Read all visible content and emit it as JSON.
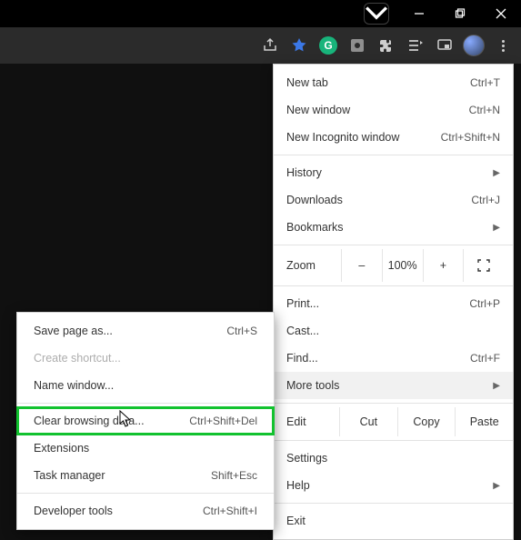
{
  "window_controls": {
    "minimize": "–",
    "maximize": "▢",
    "close": "✕"
  },
  "toolbar": {
    "icons": [
      "share-icon",
      "bookmark-star-icon",
      "grammarly-icon",
      "capture-icon",
      "extensions-puzzle-icon",
      "reading-list-icon",
      "cast-icon",
      "profile-avatar",
      "menu-kebab-icon"
    ]
  },
  "menu": {
    "new_tab": {
      "label": "New tab",
      "shortcut": "Ctrl+T"
    },
    "new_window": {
      "label": "New window",
      "shortcut": "Ctrl+N"
    },
    "new_incognito": {
      "label": "New Incognito window",
      "shortcut": "Ctrl+Shift+N"
    },
    "history": {
      "label": "History"
    },
    "downloads": {
      "label": "Downloads",
      "shortcut": "Ctrl+J"
    },
    "bookmarks": {
      "label": "Bookmarks"
    },
    "zoom": {
      "label": "Zoom",
      "minus": "–",
      "value": "100%",
      "plus": "+"
    },
    "print": {
      "label": "Print...",
      "shortcut": "Ctrl+P"
    },
    "cast": {
      "label": "Cast..."
    },
    "find": {
      "label": "Find...",
      "shortcut": "Ctrl+F"
    },
    "more_tools": {
      "label": "More tools"
    },
    "edit": {
      "label": "Edit",
      "cut": "Cut",
      "copy": "Copy",
      "paste": "Paste"
    },
    "settings": {
      "label": "Settings"
    },
    "help": {
      "label": "Help"
    },
    "exit": {
      "label": "Exit"
    }
  },
  "submenu": {
    "save_page": {
      "label": "Save page as...",
      "shortcut": "Ctrl+S"
    },
    "create_shortcut": {
      "label": "Create shortcut..."
    },
    "name_window": {
      "label": "Name window..."
    },
    "clear_browsing": {
      "label": "Clear browsing data...",
      "shortcut": "Ctrl+Shift+Del"
    },
    "extensions": {
      "label": "Extensions"
    },
    "task_manager": {
      "label": "Task manager",
      "shortcut": "Shift+Esc"
    },
    "developer_tools": {
      "label": "Developer tools",
      "shortcut": "Ctrl+Shift+I"
    }
  },
  "highlight_color": "#12c22f"
}
